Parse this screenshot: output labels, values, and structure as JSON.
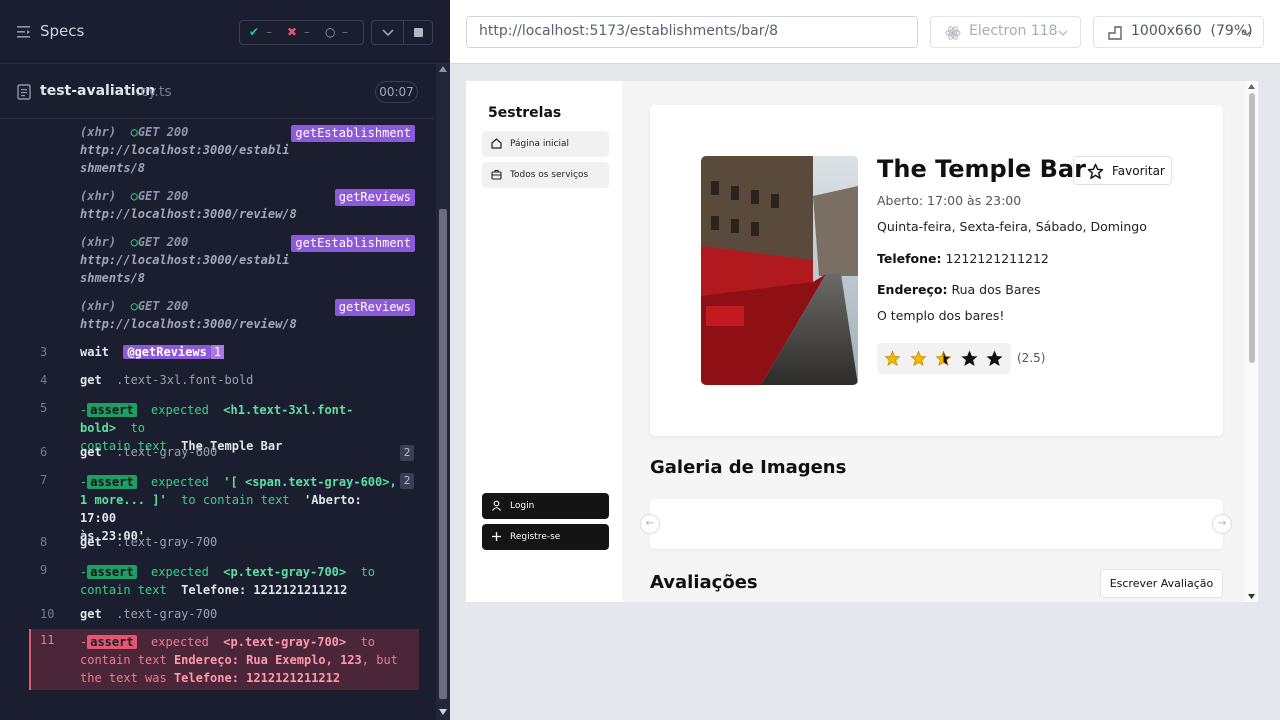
{
  "runner": {
    "specs_title": "Specs",
    "stats": {
      "passed": "–",
      "failed": "–",
      "pending": "–"
    },
    "file_name": "test-avaliation",
    "file_ext": ".cy.ts",
    "duration": "00:07"
  },
  "log": {
    "xhr": [
      {
        "type": "(xhr)",
        "method": "GET 200",
        "url1": "http://localhost:3000/establi",
        "url2": "shments/8",
        "alias": "getEstablishment"
      },
      {
        "type": "(xhr)",
        "method": "GET 200",
        "url1": "http://localhost:3000/review/8",
        "url2": "",
        "alias": "getReviews"
      },
      {
        "type": "(xhr)",
        "method": "GET 200",
        "url1": "http://localhost:3000/establi",
        "url2": "shments/8",
        "alias": "getEstablishment"
      },
      {
        "type": "(xhr)",
        "method": "GET 200",
        "url1": "http://localhost:3000/review/8",
        "url2": "",
        "alias": "getReviews"
      }
    ],
    "l3": {
      "num": "3",
      "cmd": "wait",
      "alias": "@getReviews",
      "count": "1"
    },
    "l4": {
      "num": "4",
      "cmd": "get",
      "sel": ".text-3xl.font-bold"
    },
    "l5": {
      "num": "5",
      "dash": "-",
      "assert": "assert",
      "expected": "expected",
      "target": "<h1.text-3xl.font-bold>",
      "to": "to",
      "contain": "contain text",
      "value": "The Temple Bar"
    },
    "l6": {
      "num": "6",
      "cmd": "get",
      "sel": ".text-gray-600",
      "count": "2"
    },
    "l7": {
      "num": "7",
      "dash": "-",
      "assert": "assert",
      "expected": "expected",
      "target1": "'[ <span.text-gray-600>,",
      "target2": "1 more... ]'",
      "contain": "to contain text",
      "value1": "'Aberto: 17:00",
      "value2": "às 23:00'",
      "count": "2"
    },
    "l8": {
      "num": "8",
      "cmd": "get",
      "sel": ".text-gray-700"
    },
    "l9": {
      "num": "9",
      "dash": "-",
      "assert": "assert",
      "expected": "expected",
      "target": "<p.text-gray-700>",
      "to": "to",
      "contain": "contain text",
      "value": "Telefone: 1212121211212"
    },
    "l10": {
      "num": "10",
      "cmd": "get",
      "sel": ".text-gray-700"
    },
    "l11": {
      "num": "11",
      "dash": "-",
      "assert": "assert",
      "expected": "expected",
      "target": "<p.text-gray-700>",
      "to": "to",
      "contain": "contain text",
      "value": "Endereço: Rua Exemplo, 123",
      "but": ", but",
      "was": "the text was",
      "actual": "Telefone: 1212121211212"
    }
  },
  "browser": {
    "url": "http://localhost:5173/establishments/bar/8",
    "browser_name": "Electron 118",
    "viewport": "1000x660",
    "zoom": "(79%)"
  },
  "app": {
    "brand": "5estrelas",
    "nav": [
      {
        "label": "Página inicial"
      },
      {
        "label": "Todos os serviços"
      }
    ],
    "login": "Login",
    "register": "Registre-se",
    "name": "The Temple Bar",
    "favorite": "Favoritar",
    "hours": "Aberto: 17:00 às 23:00",
    "days": "Quinta-feira, Sexta-feira, Sábado, Domingo",
    "phone_label": "Telefone:",
    "phone": "1212121211212",
    "address_label": "Endereço:",
    "address": "Rua dos Bares",
    "description": "O templo dos bares!",
    "rating": 2.5,
    "rating_text": "(2.5)",
    "gallery_title": "Galeria de Imagens",
    "reviews_title": "Avaliações",
    "write_review": "Escrever Avaliação",
    "prev_arrow": "←",
    "next_arrow": "→"
  },
  "colors": {
    "alias": "#8d58d9",
    "pass": "#1f9d64",
    "fail": "#e45770",
    "star": "#f5b800"
  }
}
